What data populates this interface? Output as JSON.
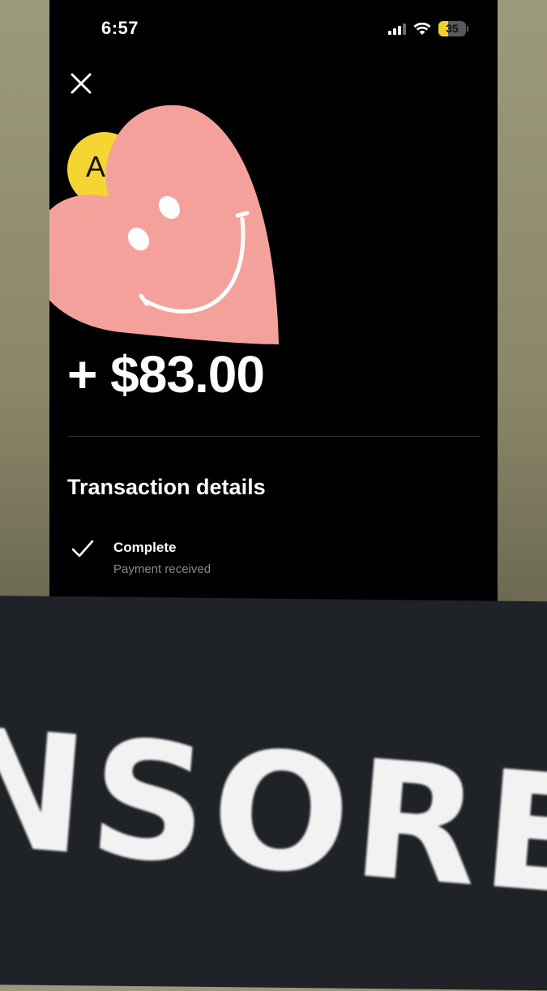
{
  "status_bar": {
    "time": "6:57",
    "battery_percent": "35",
    "battery_level": 0.35,
    "signal_bars_active": 3,
    "icons": [
      "signal-icon",
      "wifi-icon",
      "battery-icon"
    ]
  },
  "header": {
    "close_icon": "close-icon"
  },
  "payee": {
    "avatar_initial": "A"
  },
  "overlay": {
    "sticker": "smiling-heart-sticker"
  },
  "transaction": {
    "amount": "+ $83.00",
    "section_title": "Transaction details",
    "status_label": "Complete",
    "status_sub": "Payment received",
    "status_icon": "checkmark-icon"
  },
  "banner": {
    "text": "NSORE"
  },
  "colors": {
    "screen_bg": "#000000",
    "avatar_bg": "#f4d532",
    "heart": "#f4a19c",
    "battery_accent": "#f4d02e",
    "banner_bg": "#1f2226"
  }
}
